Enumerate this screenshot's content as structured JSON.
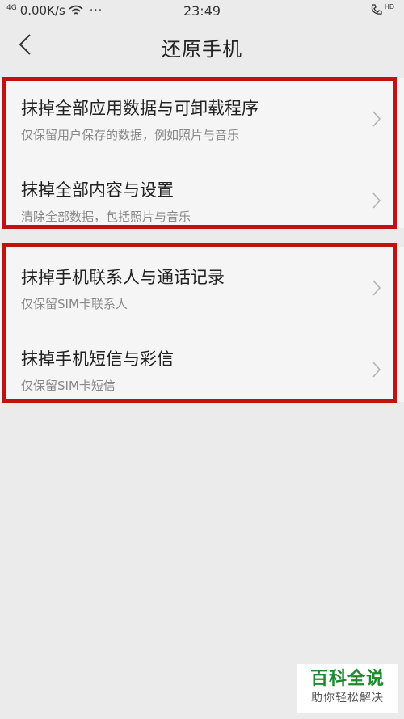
{
  "status_bar": {
    "signal": "4G",
    "network_speed": "0.00K/s",
    "more_dots": "···",
    "time": "23:49",
    "hd_badge": "HD"
  },
  "header": {
    "title": "还原手机"
  },
  "groups": [
    {
      "items": [
        {
          "title": "抹掉全部应用数据与可卸载程序",
          "subtitle": "仅保留用户保存的数据，例如照片与音乐"
        },
        {
          "title": "抹掉全部内容与设置",
          "subtitle": "清除全部数据，包括照片与音乐"
        }
      ]
    },
    {
      "items": [
        {
          "title": "抹掉手机联系人与通话记录",
          "subtitle": "仅保留SIM卡联系人"
        },
        {
          "title": "抹掉手机短信与彩信",
          "subtitle": "仅保留SIM卡短信"
        }
      ]
    }
  ],
  "watermark": {
    "main": "百科全说",
    "sub": "助你轻松解决"
  },
  "colors": {
    "highlight": "#c0120f",
    "watermark_green": "#1e8a2e"
  }
}
